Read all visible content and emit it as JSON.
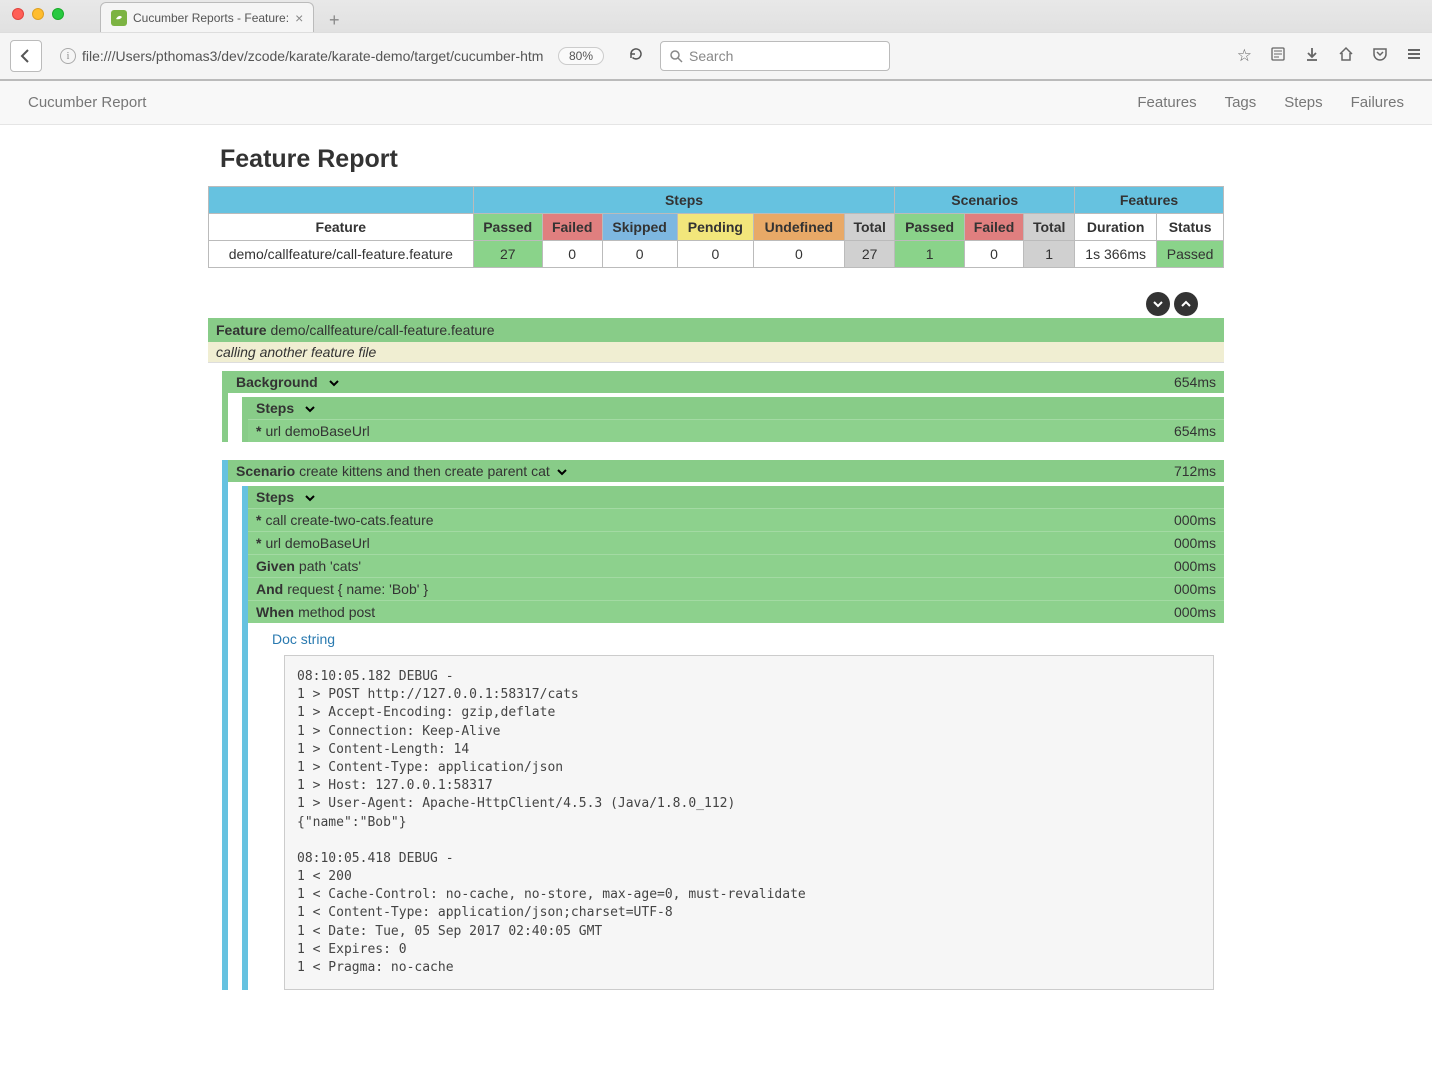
{
  "browser": {
    "tab_title": "Cucumber Reports - Feature:",
    "url": "file:///Users/pthomas3/dev/zcode/karate/karate-demo/target/cucumber-htm",
    "zoom": "80%",
    "search_placeholder": "Search"
  },
  "navbar": {
    "brand": "Cucumber Report",
    "links": [
      "Features",
      "Tags",
      "Steps",
      "Failures"
    ]
  },
  "page_title": "Feature Report",
  "stats": {
    "group_headers": {
      "steps": "Steps",
      "scenarios": "Scenarios",
      "features": "Features"
    },
    "col_headers": {
      "feature": "Feature",
      "passed": "Passed",
      "failed": "Failed",
      "skipped": "Skipped",
      "pending": "Pending",
      "undefined": "Undefined",
      "total": "Total",
      "s_passed": "Passed",
      "s_failed": "Failed",
      "s_total": "Total",
      "duration": "Duration",
      "status": "Status"
    },
    "row": {
      "feature": "demo/callfeature/call-feature.feature",
      "passed": "27",
      "failed": "0",
      "skipped": "0",
      "pending": "0",
      "undefined": "0",
      "total": "27",
      "s_passed": "1",
      "s_failed": "0",
      "s_total": "1",
      "duration": "1s 366ms",
      "status": "Passed"
    }
  },
  "feature": {
    "keyword": "Feature",
    "name": "demo/callfeature/call-feature.feature",
    "description": "calling another feature file"
  },
  "background": {
    "keyword": "Background",
    "duration": "654ms",
    "steps_label": "Steps",
    "steps": [
      {
        "keyword": "*",
        "text": "url demoBaseUrl",
        "duration": "654ms"
      }
    ]
  },
  "scenario": {
    "keyword": "Scenario",
    "name": "create kittens and then create parent cat",
    "duration": "712ms",
    "steps_label": "Steps",
    "steps": [
      {
        "keyword": "*",
        "text": "call create-two-cats.feature",
        "duration": "000ms"
      },
      {
        "keyword": "*",
        "text": "url demoBaseUrl",
        "duration": "000ms"
      },
      {
        "keyword": "Given",
        "text": "path 'cats'",
        "duration": "000ms"
      },
      {
        "keyword": "And",
        "text": "request { name: 'Bob' }",
        "duration": "000ms"
      },
      {
        "keyword": "When",
        "text": "method post",
        "duration": "000ms"
      }
    ],
    "docstring_label": "Doc string",
    "docstring": "08:10:05.182 DEBUG -\n1 > POST http://127.0.0.1:58317/cats\n1 > Accept-Encoding: gzip,deflate\n1 > Connection: Keep-Alive\n1 > Content-Length: 14\n1 > Content-Type: application/json\n1 > Host: 127.0.0.1:58317\n1 > User-Agent: Apache-HttpClient/4.5.3 (Java/1.8.0_112)\n{\"name\":\"Bob\"}\n\n08:10:05.418 DEBUG -\n1 < 200\n1 < Cache-Control: no-cache, no-store, max-age=0, must-revalidate\n1 < Content-Type: application/json;charset=UTF-8\n1 < Date: Tue, 05 Sep 2017 02:40:05 GMT\n1 < Expires: 0\n1 < Pragma: no-cache"
  }
}
